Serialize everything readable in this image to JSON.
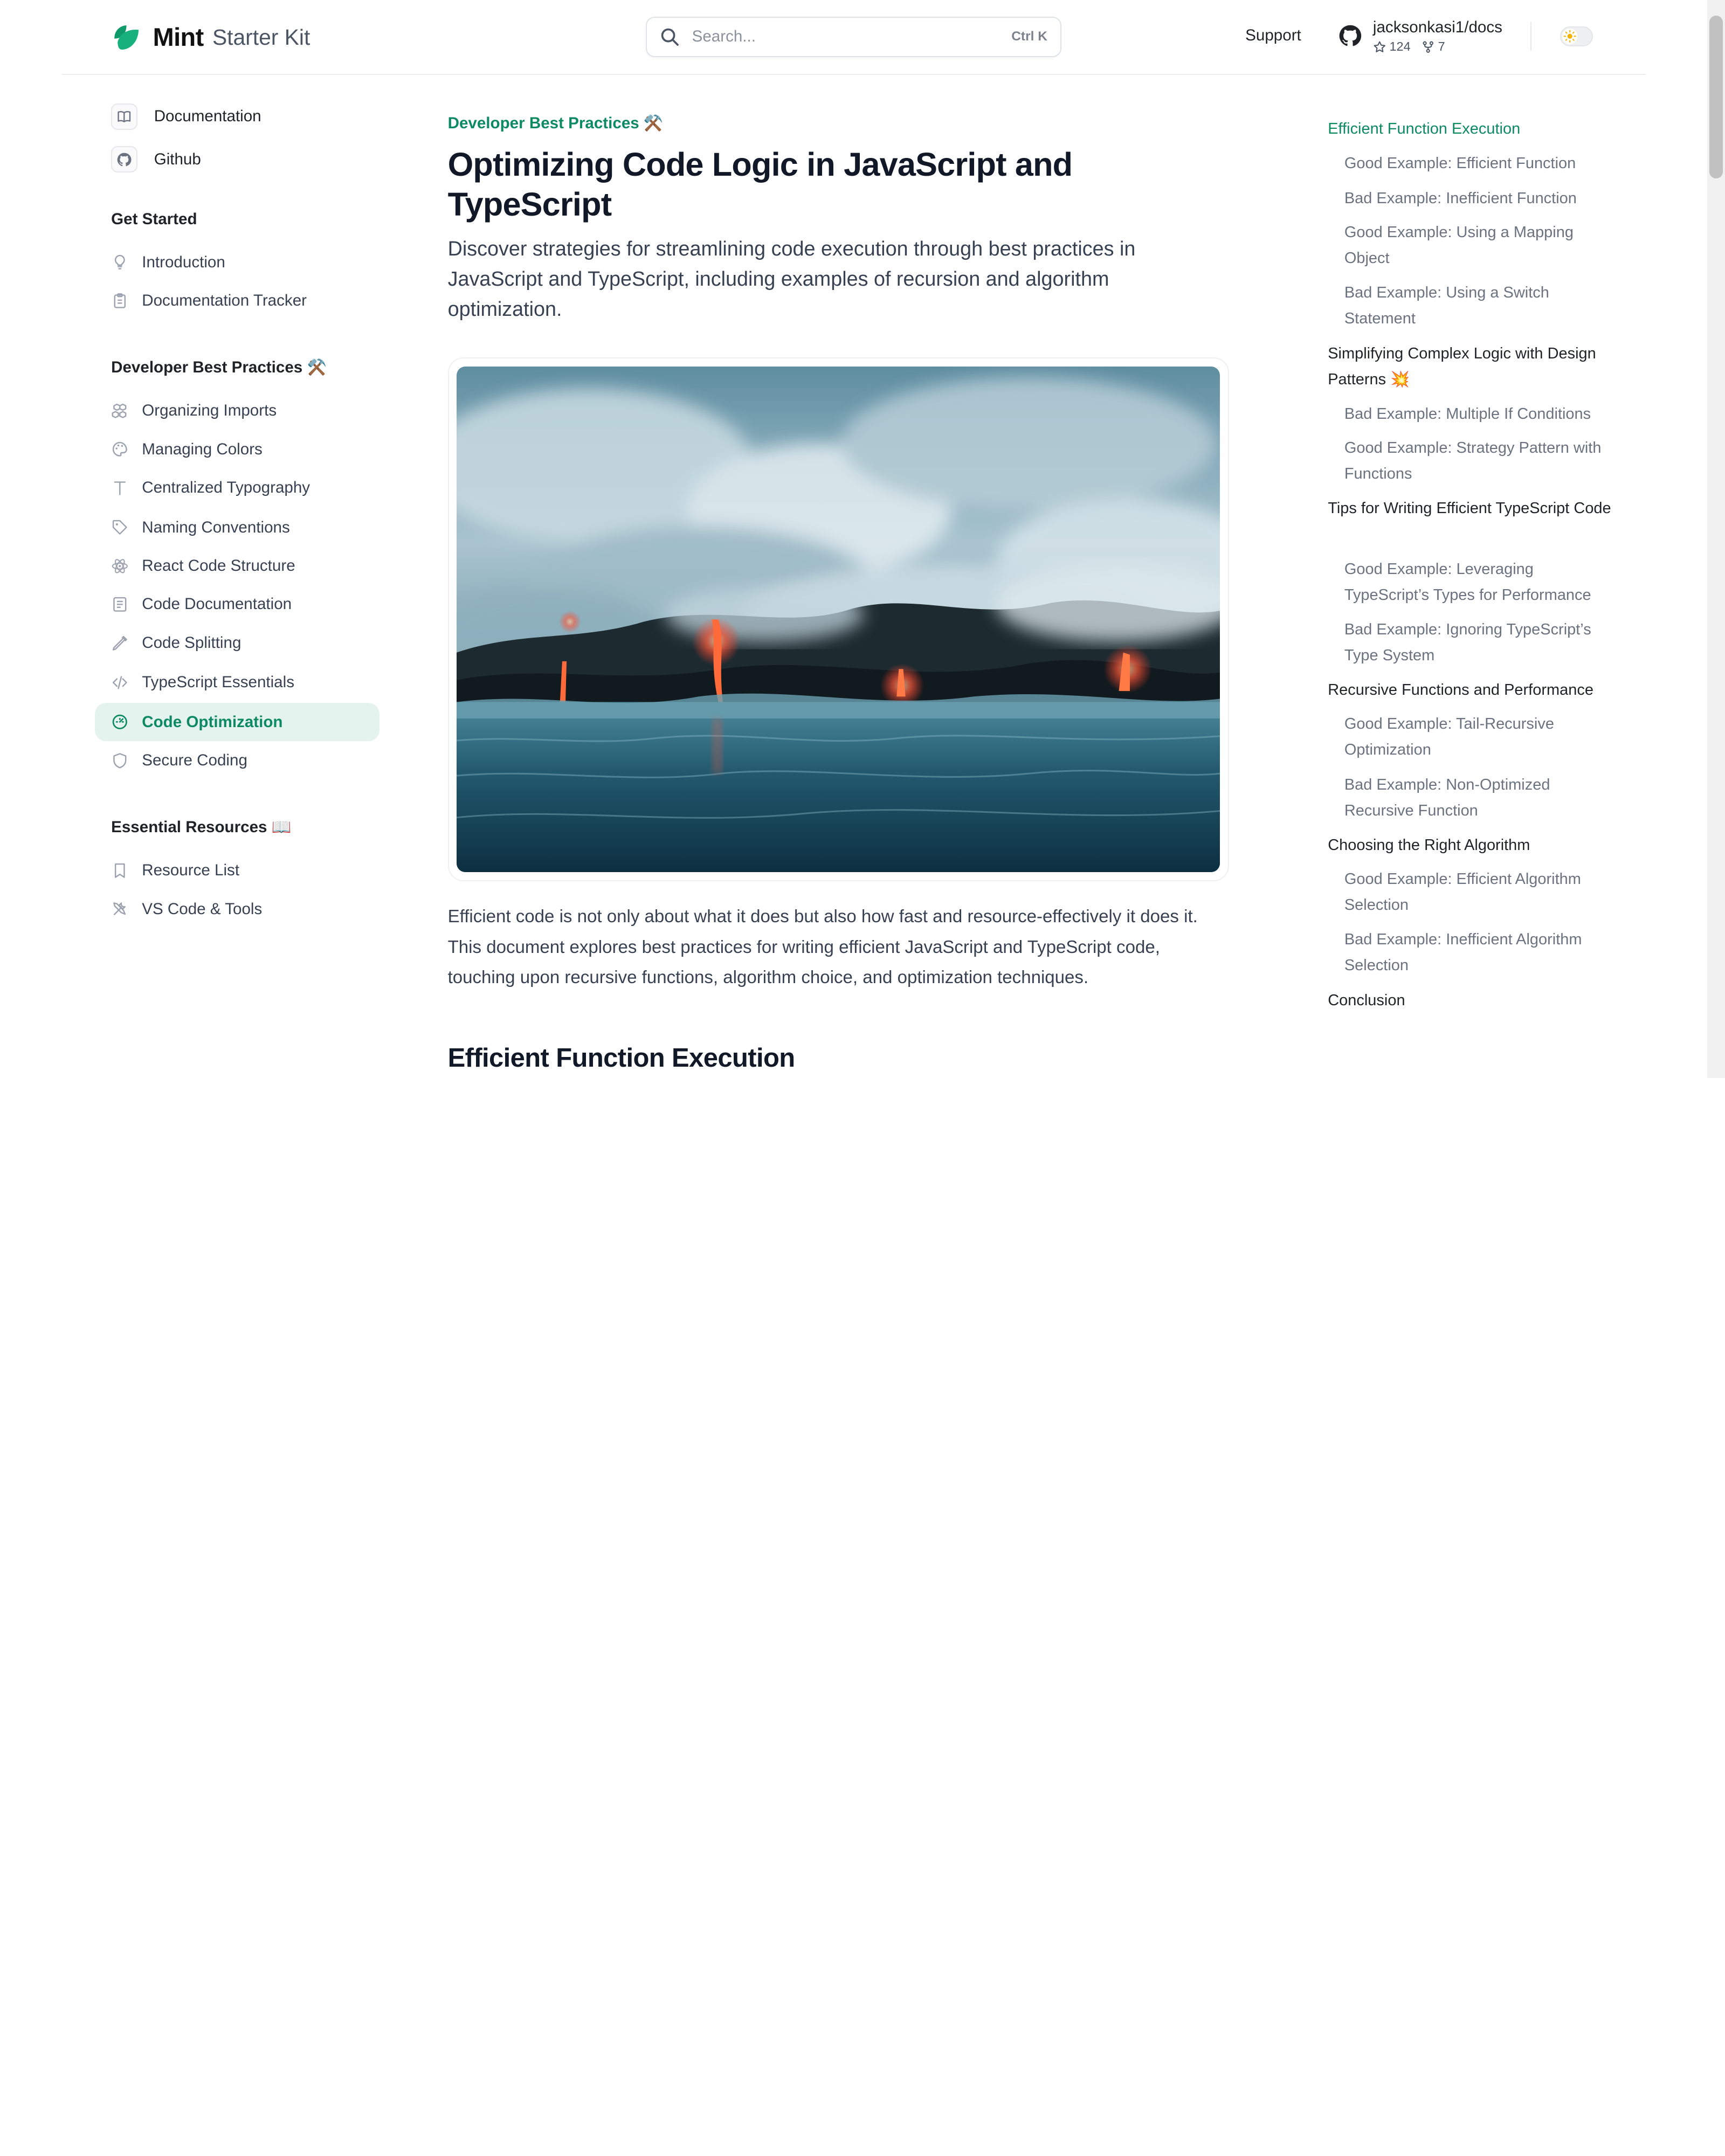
{
  "header": {
    "logo_mint": "Mint",
    "logo_kit": "Starter Kit",
    "search_placeholder": "Search...",
    "search_shortcut": "Ctrl K",
    "support": "Support",
    "github_repo": "jacksonkasi1/docs",
    "github_stars": "124",
    "github_forks": "7"
  },
  "sidebar": {
    "top_links": [
      {
        "label": "Documentation",
        "icon": "book-icon"
      },
      {
        "label": "Github",
        "icon": "github-icon"
      }
    ],
    "groups": [
      {
        "title": "Get Started",
        "items": [
          {
            "label": "Introduction",
            "icon": "lightbulb-icon"
          },
          {
            "label": "Documentation Tracker",
            "icon": "clipboard-icon"
          }
        ]
      },
      {
        "title": "Developer Best Practices ⚒️",
        "items": [
          {
            "label": "Organizing Imports",
            "icon": "boxes-icon"
          },
          {
            "label": "Managing Colors",
            "icon": "palette-icon"
          },
          {
            "label": "Centralized Typography",
            "icon": "type-icon"
          },
          {
            "label": "Naming Conventions",
            "icon": "tag-icon"
          },
          {
            "label": "React Code Structure",
            "icon": "atom-icon"
          },
          {
            "label": "Code Documentation",
            "icon": "document-icon"
          },
          {
            "label": "Code Splitting",
            "icon": "pen-icon"
          },
          {
            "label": "TypeScript Essentials",
            "icon": "code-icon"
          },
          {
            "label": "Code Optimization",
            "icon": "gauge-icon",
            "active": true
          },
          {
            "label": "Secure Coding",
            "icon": "shield-icon"
          }
        ]
      },
      {
        "title": "Essential Resources 📖",
        "items": [
          {
            "label": "Resource List",
            "icon": "bookmark-icon"
          },
          {
            "label": "VS Code & Tools",
            "icon": "tools-icon"
          }
        ]
      }
    ]
  },
  "main": {
    "eyebrow": "Developer Best Practices ⚒️",
    "title": "Optimizing Code Logic in JavaScript and TypeScript",
    "lead": "Discover strategies for streamlining code execution through best practices in JavaScript and TypeScript, including examples of recursion and algorithm optimization.",
    "body": "Efficient code is not only about what it does but also how fast and resource-effectively it does it. This document explores best practices for writing efficient JavaScript and TypeScript code, touching upon recursive functions, algorithm choice, and optimization techniques.",
    "section_heading": "Efficient Function Execution"
  },
  "toc": [
    {
      "label": "Efficient Function Execution",
      "level": 1,
      "active": true
    },
    {
      "label": "Good Example: Efficient Function",
      "level": 2
    },
    {
      "label": "Bad Example: Inefficient Function",
      "level": 2
    },
    {
      "label": "Good Example: Using a Mapping Object",
      "level": 2
    },
    {
      "label": "Bad Example: Using a Switch Statement",
      "level": 2
    },
    {
      "label": "Simplifying Complex Logic with Design Patterns 💥",
      "level": 1
    },
    {
      "label": "Bad Example: Multiple If Conditions",
      "level": 2
    },
    {
      "label": "Good Example: Strategy Pattern with Functions",
      "level": 2
    },
    {
      "label": "Tips for Writing Efficient TypeScript Code",
      "level": 1
    },
    {
      "label": "Good Example: Leveraging TypeScript’s Types for Performance",
      "level": 2
    },
    {
      "label": "Bad Example: Ignoring TypeScript’s Type System",
      "level": 2
    },
    {
      "label": "Recursive Functions and Performance",
      "level": 1
    },
    {
      "label": "Good Example: Tail-Recursive Optimization",
      "level": 2
    },
    {
      "label": "Bad Example: Non-Optimized Recursive Function",
      "level": 2
    },
    {
      "label": "Choosing the Right Algorithm",
      "level": 1
    },
    {
      "label": "Good Example: Efficient Algorithm Selection",
      "level": 2
    },
    {
      "label": "Bad Example: Inefficient Algorithm Selection",
      "level": 2
    },
    {
      "label": "Conclusion",
      "level": 1
    }
  ],
  "colors": {
    "accent": "#0e8a63",
    "active_bg": "#e4f3ee"
  }
}
